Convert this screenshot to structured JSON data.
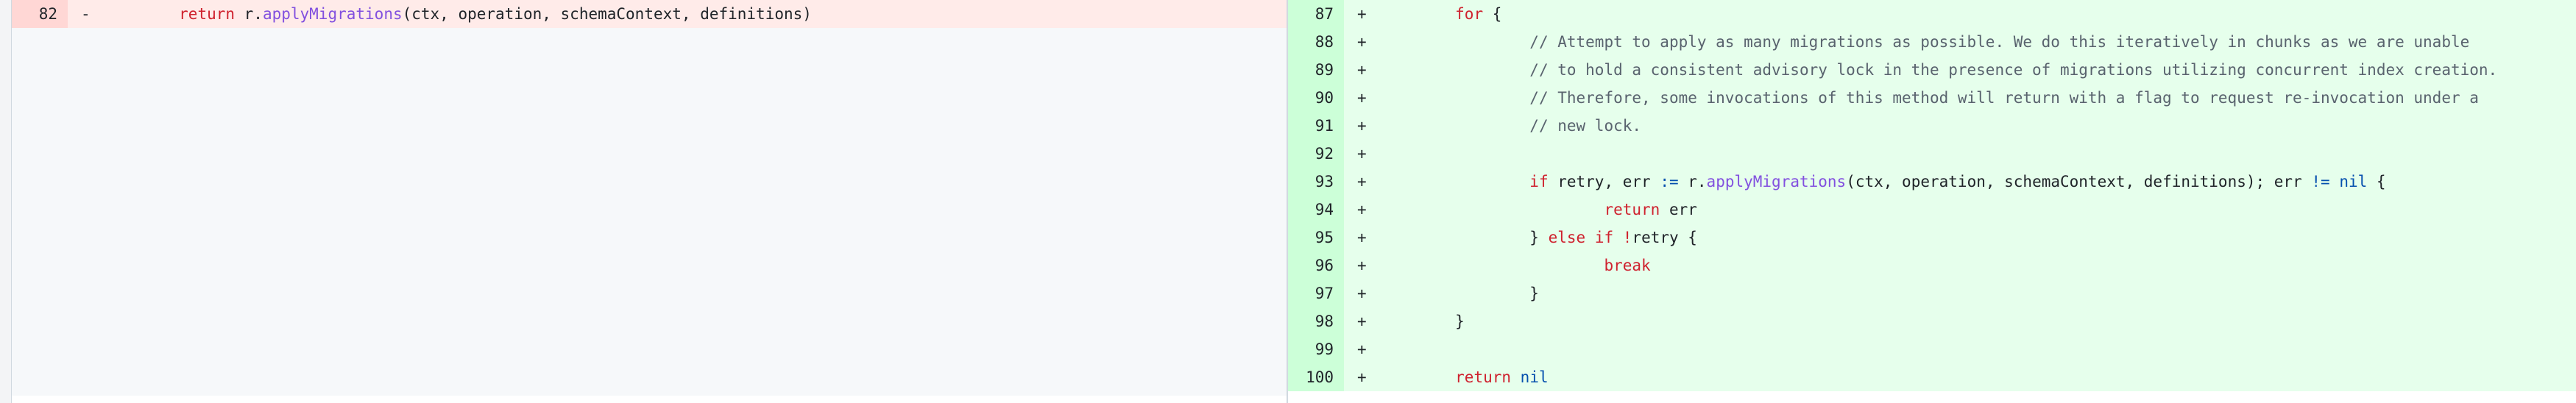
{
  "colors": {
    "deleted_line_bg": "#ffebe9",
    "deleted_number_bg": "#ffd7d5",
    "added_line_bg": "#e6ffec",
    "added_number_bg": "#ccffd8",
    "keyword": "#cf222e",
    "function": "#8250df",
    "comment": "#59636e",
    "operator": "#0550ae"
  },
  "left": {
    "lines": [
      {
        "number": "82",
        "sign": "-",
        "segments": [
          {
            "text": "        ",
            "cls": ""
          },
          {
            "text": "return",
            "cls": "kw"
          },
          {
            "text": " r.",
            "cls": ""
          },
          {
            "text": "applyMigrations",
            "cls": "fn"
          },
          {
            "text": "(ctx, operation, schemaContext, definitions)",
            "cls": ""
          }
        ]
      }
    ]
  },
  "right": {
    "lines": [
      {
        "number": "87",
        "sign": "+",
        "segments": [
          {
            "text": "        ",
            "cls": ""
          },
          {
            "text": "for",
            "cls": "kw"
          },
          {
            "text": " {",
            "cls": ""
          }
        ]
      },
      {
        "number": "88",
        "sign": "+",
        "segments": [
          {
            "text": "                ",
            "cls": ""
          },
          {
            "text": "// Attempt to apply as many migrations as possible. We do this iteratively in chunks as we are unable",
            "cls": "cm"
          }
        ]
      },
      {
        "number": "89",
        "sign": "+",
        "segments": [
          {
            "text": "                ",
            "cls": ""
          },
          {
            "text": "// to hold a consistent advisory lock in the presence of migrations utilizing concurrent index creation.",
            "cls": "cm"
          }
        ]
      },
      {
        "number": "90",
        "sign": "+",
        "segments": [
          {
            "text": "                ",
            "cls": ""
          },
          {
            "text": "// Therefore, some invocations of this method will return with a flag to request re-invocation under a",
            "cls": "cm"
          }
        ]
      },
      {
        "number": "91",
        "sign": "+",
        "segments": [
          {
            "text": "                ",
            "cls": ""
          },
          {
            "text": "// new lock.",
            "cls": "cm"
          }
        ]
      },
      {
        "number": "92",
        "sign": "+",
        "segments": []
      },
      {
        "number": "93",
        "sign": "+",
        "segments": [
          {
            "text": "                ",
            "cls": ""
          },
          {
            "text": "if",
            "cls": "kw"
          },
          {
            "text": " retry, err ",
            "cls": ""
          },
          {
            "text": ":=",
            "cls": "op"
          },
          {
            "text": " r.",
            "cls": ""
          },
          {
            "text": "applyMigrations",
            "cls": "fn"
          },
          {
            "text": "(ctx, operation, schemaContext, definitions); err ",
            "cls": ""
          },
          {
            "text": "!=",
            "cls": "op"
          },
          {
            "text": " ",
            "cls": ""
          },
          {
            "text": "nil",
            "cls": "op"
          },
          {
            "text": " {",
            "cls": ""
          }
        ]
      },
      {
        "number": "94",
        "sign": "+",
        "segments": [
          {
            "text": "                        ",
            "cls": ""
          },
          {
            "text": "return",
            "cls": "kw"
          },
          {
            "text": " err",
            "cls": ""
          }
        ]
      },
      {
        "number": "95",
        "sign": "+",
        "segments": [
          {
            "text": "                } ",
            "cls": ""
          },
          {
            "text": "else",
            "cls": "kw"
          },
          {
            "text": " ",
            "cls": ""
          },
          {
            "text": "if",
            "cls": "kw"
          },
          {
            "text": " ",
            "cls": ""
          },
          {
            "text": "!",
            "cls": "kw"
          },
          {
            "text": "retry {",
            "cls": ""
          }
        ]
      },
      {
        "number": "96",
        "sign": "+",
        "segments": [
          {
            "text": "                        ",
            "cls": ""
          },
          {
            "text": "break",
            "cls": "kw"
          }
        ]
      },
      {
        "number": "97",
        "sign": "+",
        "segments": [
          {
            "text": "                }",
            "cls": ""
          }
        ]
      },
      {
        "number": "98",
        "sign": "+",
        "segments": [
          {
            "text": "        }",
            "cls": ""
          }
        ]
      },
      {
        "number": "99",
        "sign": "+",
        "segments": []
      },
      {
        "number": "100",
        "sign": "+",
        "segments": [
          {
            "text": "        ",
            "cls": ""
          },
          {
            "text": "return",
            "cls": "kw"
          },
          {
            "text": " ",
            "cls": ""
          },
          {
            "text": "nil",
            "cls": "op"
          }
        ]
      }
    ]
  }
}
